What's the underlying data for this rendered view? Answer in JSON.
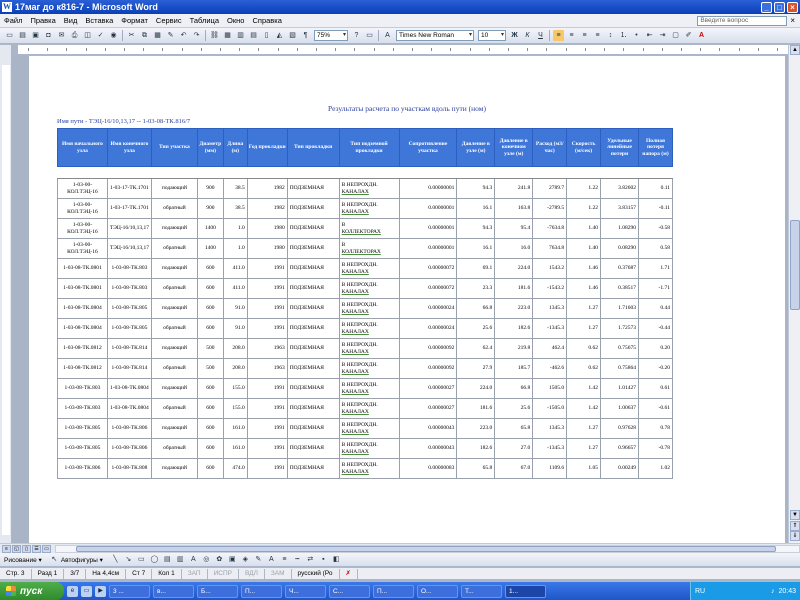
{
  "window": {
    "title": "17маг до к816-7 - Microsoft Word",
    "minimize": "_",
    "maximize": "□",
    "close": "×"
  },
  "menu": {
    "items": [
      "Файл",
      "Правка",
      "Вид",
      "Вставка",
      "Формат",
      "Сервис",
      "Таблица",
      "Окно",
      "Справка"
    ],
    "ask_placeholder": "Введите вопрос",
    "close_doc": "×"
  },
  "toolbar": {
    "zoom": "75%",
    "font": "Times New Roman",
    "size": "10"
  },
  "report": {
    "title": "Результаты расчета по участкам вдоль пути (ном)",
    "path": "Имя пути - ТЭЦ-16/10,13,17 -- 1-03-08-ТК.816/7",
    "headers": [
      "Имя начального узла",
      "Имя конечного узла",
      "Тип участка",
      "Диаметр (мм)",
      "Длина (м)",
      "Год прокладки",
      "Тип прокладки",
      "Тип подземной прокладки",
      "Сопротивление участка",
      "Давление в узле (м)",
      "Давление в конечном узле (м)",
      "Расход (м3/час)",
      "Скорость (м/сек)",
      "Удельные линейные потери",
      "Полная потеря напора (м)"
    ],
    "rows": [
      [
        "1-03-00-КОЛ.ТЭЦ-16",
        "1-03-17-ТК.1701",
        "подающий",
        "900",
        "38.5",
        "1982",
        "ПОДЗЕМНАЯ",
        "В НЕПРОХДН.",
        "КАНАЛАХ",
        "0.00000001",
        "94.3",
        "241.8",
        "2789.7",
        "1.22",
        "3.82602",
        "0.11"
      ],
      [
        "1-03-00-КОЛ.ТЭЦ-16",
        "1-03-17-ТК.1701",
        "обратный",
        "900",
        "38.5",
        "1982",
        "ПОДЗЕМНАЯ",
        "В НЕПРОХДН.",
        "КАНАЛАХ",
        "0.00000001",
        "16.1",
        "163.8",
        "-2789.5",
        "1.22",
        "3.83157",
        "-0.11"
      ],
      [
        "1-03-00-КОЛ.ТЭЦ-16",
        "ТЭЦ-16/10,13,17",
        "подающий",
        "1400",
        "1.0",
        "1980",
        "ПОДЗЕМНАЯ",
        "В",
        "КОЛЛЕКТОРАХ",
        "0.00000001",
        "94.3",
        "95.4",
        "-7634.8",
        "1.40",
        "1.08290",
        "-0.58"
      ],
      [
        "1-03-00-КОЛ.ТЭЦ-16",
        "ТЭЦ-16/10,13,17",
        "обратный",
        "1400",
        "1.0",
        "1980",
        "ПОДЗЕМНАЯ",
        "В",
        "КОЛЛЕКТОРАХ",
        "0.00000001",
        "16.1",
        "16.0",
        "7634.8",
        "1.40",
        "0.08290",
        "0.58"
      ],
      [
        "1-03-08-ТК.0801",
        "1-03-08-ТК.803",
        "подающий",
        "600",
        "411.0",
        "1991",
        "ПОДЗЕМНАЯ",
        "В НЕПРОХДН.",
        "КАНАЛАХ",
        "0.00000072",
        "69.1",
        "224.0",
        "1543.2",
        "1.46",
        "0.37687",
        "1.71"
      ],
      [
        "1-03-08-ТК.0801",
        "1-03-08-ТК.803",
        "обратный",
        "600",
        "411.0",
        "1991",
        "ПОДЗЕМНАЯ",
        "В НЕПРОХДН.",
        "КАНАЛАХ",
        "0.00000072",
        "23.3",
        "181.6",
        "-1543.2",
        "1.46",
        "0.38517",
        "-1.71"
      ],
      [
        "1-03-08-ТК.0804",
        "1-03-08-ТК.805",
        "подающий",
        "600",
        "91.0",
        "1991",
        "ПОДЗЕМНАЯ",
        "В НЕПРОХДН.",
        "КАНАЛАХ",
        "0.00000024",
        "66.8",
        "223.0",
        "1345.3",
        "1.27",
        "1.71603",
        "0.44"
      ],
      [
        "1-03-08-ТК.0804",
        "1-03-08-ТК.805",
        "обратный",
        "600",
        "91.0",
        "1991",
        "ПОДЗЕМНАЯ",
        "В НЕПРОХДН.",
        "КАНАЛАХ",
        "0.00000024",
        "25.6",
        "182.6",
        "-1345.3",
        "1.27",
        "1.72573",
        "-0.44"
      ],
      [
        "1-03-08-ТК.0812",
        "1-03-08-ТК.814",
        "подающий",
        "500",
        "208.0",
        "1963",
        "ПОДЗЕМНАЯ",
        "В НЕПРОХДН.",
        "КАНАЛАХ",
        "0.00000092",
        "62.4",
        "219.8",
        "462.4",
        "0.62",
        "0.75675",
        "0.20"
      ],
      [
        "1-03-08-ТК.0812",
        "1-03-08-ТК.814",
        "обратный",
        "500",
        "208.0",
        "1963",
        "ПОДЗЕМНАЯ",
        "В НЕПРОХДН.",
        "КАНАЛАХ",
        "0.00000092",
        "27.9",
        "185.7",
        "-462.6",
        "0.62",
        "0.75864",
        "-0.20"
      ],
      [
        "1-03-08-ТК.803",
        "1-03-08-ТК.0804",
        "подающий",
        "600",
        "155.0",
        "1991",
        "ПОДЗЕМНАЯ",
        "В НЕПРОХДН.",
        "КАНАЛАХ",
        "0.00000027",
        "224.0",
        "66.8",
        "1505.0",
        "1.42",
        "1.01427",
        "0.61"
      ],
      [
        "1-03-08-ТК.803",
        "1-03-08-ТК.0804",
        "обратный",
        "600",
        "155.0",
        "1991",
        "ПОДЗЕМНАЯ",
        "В НЕПРОХДН.",
        "КАНАЛАХ",
        "0.00000027",
        "181.6",
        "25.6",
        "-1505.0",
        "1.42",
        "1.00637",
        "-0.61"
      ],
      [
        "1-03-08-ТК.805",
        "1-03-08-ТК.806",
        "подающий",
        "600",
        "161.0",
        "1991",
        "ПОДЗЕМНАЯ",
        "В НЕПРОХДН.",
        "КАНАЛАХ",
        "0.00000043",
        "223.0",
        "65.8",
        "1345.3",
        "1.27",
        "0.97628",
        "0.78"
      ],
      [
        "1-03-08-ТК.805",
        "1-03-08-ТК.806",
        "обратный",
        "600",
        "161.0",
        "1991",
        "ПОДЗЕМНАЯ",
        "В НЕПРОХДН.",
        "КАНАЛАХ",
        "0.00000043",
        "182.6",
        "27.0",
        "-1345.3",
        "1.27",
        "0.96657",
        "-0.78"
      ],
      [
        "1-03-08-ТК.806",
        "1-03-08-ТК.808",
        "подающий",
        "600",
        "474.0",
        "1991",
        "ПОДЗЕМНАЯ",
        "В НЕПРОХДН.",
        "КАНАЛАХ",
        "0.00000083",
        "65.8",
        "67.0",
        "1109.6",
        "1.05",
        "0.00249",
        "1.02"
      ]
    ]
  },
  "drawbar": {
    "draw": "Рисование ▾",
    "autoshapes": "Автофигуры ▾"
  },
  "status": {
    "page": "Стр. 3",
    "section": "Разд 1",
    "pages": "3/7",
    "at": "На 4,4см",
    "line": "Ст 7",
    "col": "Кол 1",
    "rec": "ЗАП",
    "trk": "ИСПР",
    "ext": "ВДЛ",
    "ovr": "ЗАМ",
    "lang": "русский (Ро"
  },
  "taskbar": {
    "start": "пуск",
    "tasks": [
      "3 ...",
      "в...",
      "Б...",
      "П...",
      "Ч...",
      "С...",
      "П...",
      "О...",
      "Т...",
      "1..."
    ],
    "lang": "RU",
    "clock": "20:43"
  },
  "colors": {
    "header_blue": "#3f77d8",
    "title_blue": "#2b3fa0"
  }
}
